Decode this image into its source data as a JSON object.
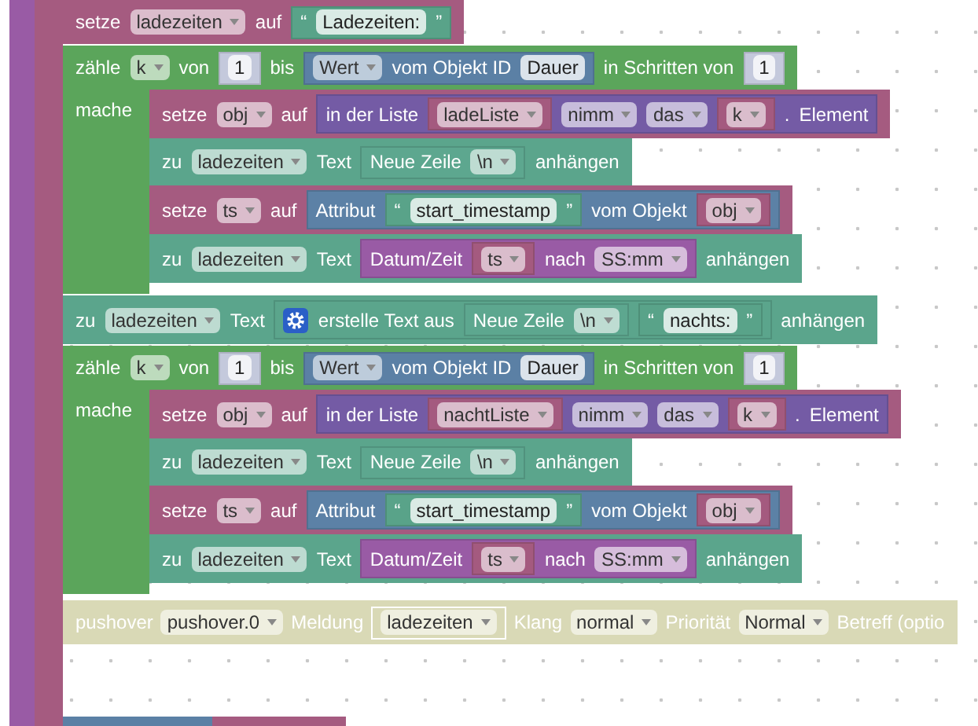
{
  "stack": [
    {
      "kind": "set",
      "parts": [
        {
          "kind": "label",
          "text": "setze"
        },
        {
          "kind": "dropdown",
          "text": "ladezeiten"
        },
        {
          "kind": "label",
          "text": "auf"
        },
        {
          "kind": "block",
          "block": {
            "kind": "string",
            "parts": [
              {
                "kind": "label",
                "text": "“"
              },
              {
                "kind": "field",
                "text": "Ladezeiten:"
              },
              {
                "kind": "label",
                "text": "”"
              }
            ]
          }
        }
      ]
    },
    {
      "kind": "count",
      "parts": [
        {
          "kind": "label",
          "text": "zähle"
        },
        {
          "kind": "dropdown",
          "text": "k"
        },
        {
          "kind": "label",
          "text": "von"
        },
        {
          "kind": "block",
          "block": {
            "kind": "number",
            "parts": [
              {
                "kind": "field",
                "text": "1"
              }
            ]
          }
        },
        {
          "kind": "label",
          "text": "bis"
        },
        {
          "kind": "block",
          "block": {
            "kind": "object_value",
            "parts": [
              {
                "kind": "dropdown",
                "text": "Wert"
              },
              {
                "kind": "label",
                "text": "vom Objekt ID"
              },
              {
                "kind": "field",
                "text": "Dauer"
              }
            ]
          }
        },
        {
          "kind": "label",
          "text": "in Schritten von"
        },
        {
          "kind": "block",
          "block": {
            "kind": "number",
            "parts": [
              {
                "kind": "field",
                "text": "1"
              }
            ]
          }
        }
      ],
      "body_label": "mache",
      "body": [
        {
          "kind": "set",
          "parts": [
            {
              "kind": "label",
              "text": "setze"
            },
            {
              "kind": "dropdown",
              "text": "obj"
            },
            {
              "kind": "label",
              "text": "auf"
            },
            {
              "kind": "block",
              "block": {
                "kind": "list_get",
                "parts": [
                  {
                    "kind": "label",
                    "text": "in der Liste"
                  },
                  {
                    "kind": "block",
                    "block": {
                      "kind": "var",
                      "parts": [
                        {
                          "kind": "dropdown",
                          "text": "ladeListe"
                        }
                      ]
                    }
                  },
                  {
                    "kind": "dropdown",
                    "text": "nimm"
                  },
                  {
                    "kind": "dropdown",
                    "text": "das"
                  },
                  {
                    "kind": "block",
                    "block": {
                      "kind": "var",
                      "parts": [
                        {
                          "kind": "dropdown",
                          "text": "k"
                        }
                      ]
                    }
                  },
                  {
                    "kind": "label",
                    "text": "."
                  },
                  {
                    "kind": "label",
                    "text": "Element"
                  }
                ]
              }
            }
          ]
        },
        {
          "kind": "append",
          "parts": [
            {
              "kind": "label",
              "text": "zu"
            },
            {
              "kind": "dropdown",
              "text": "ladezeiten"
            },
            {
              "kind": "label",
              "text": "Text"
            },
            {
              "kind": "block",
              "block": {
                "kind": "newline",
                "parts": [
                  {
                    "kind": "label",
                    "text": "Neue Zeile"
                  },
                  {
                    "kind": "dropdown",
                    "text": "\\n"
                  }
                ]
              }
            },
            {
              "kind": "label",
              "text": "anhängen"
            }
          ]
        },
        {
          "kind": "set",
          "parts": [
            {
              "kind": "label",
              "text": "setze"
            },
            {
              "kind": "dropdown",
              "text": "ts"
            },
            {
              "kind": "label",
              "text": "auf"
            },
            {
              "kind": "block",
              "block": {
                "kind": "attribute",
                "parts": [
                  {
                    "kind": "label",
                    "text": "Attribut"
                  },
                  {
                    "kind": "block",
                    "block": {
                      "kind": "string",
                      "parts": [
                        {
                          "kind": "label",
                          "text": "“"
                        },
                        {
                          "kind": "field",
                          "text": "start_timestamp"
                        },
                        {
                          "kind": "label",
                          "text": "”"
                        }
                      ]
                    }
                  },
                  {
                    "kind": "label",
                    "text": "vom Objekt"
                  },
                  {
                    "kind": "block",
                    "block": {
                      "kind": "var",
                      "parts": [
                        {
                          "kind": "dropdown",
                          "text": "obj"
                        }
                      ]
                    }
                  }
                ]
              }
            }
          ]
        },
        {
          "kind": "append",
          "parts": [
            {
              "kind": "label",
              "text": "zu"
            },
            {
              "kind": "dropdown",
              "text": "ladezeiten"
            },
            {
              "kind": "label",
              "text": "Text"
            },
            {
              "kind": "block",
              "block": {
                "kind": "datetime",
                "parts": [
                  {
                    "kind": "label",
                    "text": "Datum/Zeit"
                  },
                  {
                    "kind": "block",
                    "block": {
                      "kind": "var",
                      "parts": [
                        {
                          "kind": "dropdown",
                          "text": "ts"
                        }
                      ]
                    }
                  },
                  {
                    "kind": "label",
                    "text": "nach"
                  },
                  {
                    "kind": "dropdown",
                    "text": "SS:mm"
                  }
                ]
              }
            },
            {
              "kind": "label",
              "text": "anhängen"
            }
          ]
        }
      ]
    },
    {
      "kind": "append",
      "parts": [
        {
          "kind": "label",
          "text": "zu"
        },
        {
          "kind": "dropdown",
          "text": "ladezeiten"
        },
        {
          "kind": "label",
          "text": "Text"
        },
        {
          "kind": "block",
          "block": {
            "kind": "create_text",
            "parts": [
              {
                "kind": "mutator"
              },
              {
                "kind": "label",
                "text": "erstelle Text aus"
              },
              {
                "kind": "block",
                "block": {
                  "kind": "newline",
                  "parts": [
                    {
                      "kind": "label",
                      "text": "Neue Zeile"
                    },
                    {
                      "kind": "dropdown",
                      "text": "\\n"
                    }
                  ]
                }
              },
              {
                "kind": "block",
                "block": {
                  "kind": "string",
                  "parts": [
                    {
                      "kind": "label",
                      "text": "“"
                    },
                    {
                      "kind": "field",
                      "text": "nachts:"
                    },
                    {
                      "kind": "label",
                      "text": "”"
                    }
                  ]
                }
              }
            ]
          }
        },
        {
          "kind": "label",
          "text": "anhängen"
        }
      ]
    },
    {
      "kind": "count",
      "parts": [
        {
          "kind": "label",
          "text": "zähle"
        },
        {
          "kind": "dropdown",
          "text": "k"
        },
        {
          "kind": "label",
          "text": "von"
        },
        {
          "kind": "block",
          "block": {
            "kind": "number",
            "parts": [
              {
                "kind": "field",
                "text": "1"
              }
            ]
          }
        },
        {
          "kind": "label",
          "text": "bis"
        },
        {
          "kind": "block",
          "block": {
            "kind": "object_value",
            "parts": [
              {
                "kind": "dropdown",
                "text": "Wert"
              },
              {
                "kind": "label",
                "text": "vom Objekt ID"
              },
              {
                "kind": "field",
                "text": "Dauer"
              }
            ]
          }
        },
        {
          "kind": "label",
          "text": "in Schritten von"
        },
        {
          "kind": "block",
          "block": {
            "kind": "number",
            "parts": [
              {
                "kind": "field",
                "text": "1"
              }
            ]
          }
        }
      ],
      "body_label": "mache",
      "body": [
        {
          "kind": "set",
          "parts": [
            {
              "kind": "label",
              "text": "setze"
            },
            {
              "kind": "dropdown",
              "text": "obj"
            },
            {
              "kind": "label",
              "text": "auf"
            },
            {
              "kind": "block",
              "block": {
                "kind": "list_get",
                "parts": [
                  {
                    "kind": "label",
                    "text": "in der Liste"
                  },
                  {
                    "kind": "block",
                    "block": {
                      "kind": "var",
                      "parts": [
                        {
                          "kind": "dropdown",
                          "text": "nachtListe"
                        }
                      ]
                    }
                  },
                  {
                    "kind": "dropdown",
                    "text": "nimm"
                  },
                  {
                    "kind": "dropdown",
                    "text": "das"
                  },
                  {
                    "kind": "block",
                    "block": {
                      "kind": "var",
                      "parts": [
                        {
                          "kind": "dropdown",
                          "text": "k"
                        }
                      ]
                    }
                  },
                  {
                    "kind": "label",
                    "text": "."
                  },
                  {
                    "kind": "label",
                    "text": "Element"
                  }
                ]
              }
            }
          ]
        },
        {
          "kind": "append",
          "parts": [
            {
              "kind": "label",
              "text": "zu"
            },
            {
              "kind": "dropdown",
              "text": "ladezeiten"
            },
            {
              "kind": "label",
              "text": "Text"
            },
            {
              "kind": "block",
              "block": {
                "kind": "newline",
                "parts": [
                  {
                    "kind": "label",
                    "text": "Neue Zeile"
                  },
                  {
                    "kind": "dropdown",
                    "text": "\\n"
                  }
                ]
              }
            },
            {
              "kind": "label",
              "text": "anhängen"
            }
          ]
        },
        {
          "kind": "set",
          "parts": [
            {
              "kind": "label",
              "text": "setze"
            },
            {
              "kind": "dropdown",
              "text": "ts"
            },
            {
              "kind": "label",
              "text": "auf"
            },
            {
              "kind": "block",
              "block": {
                "kind": "attribute",
                "parts": [
                  {
                    "kind": "label",
                    "text": "Attribut"
                  },
                  {
                    "kind": "block",
                    "block": {
                      "kind": "string",
                      "parts": [
                        {
                          "kind": "label",
                          "text": "“"
                        },
                        {
                          "kind": "field",
                          "text": "start_timestamp"
                        },
                        {
                          "kind": "label",
                          "text": "”"
                        }
                      ]
                    }
                  },
                  {
                    "kind": "label",
                    "text": "vom Objekt"
                  },
                  {
                    "kind": "block",
                    "block": {
                      "kind": "var",
                      "parts": [
                        {
                          "kind": "dropdown",
                          "text": "obj"
                        }
                      ]
                    }
                  }
                ]
              }
            }
          ]
        },
        {
          "kind": "append",
          "parts": [
            {
              "kind": "label",
              "text": "zu"
            },
            {
              "kind": "dropdown",
              "text": "ladezeiten"
            },
            {
              "kind": "label",
              "text": "Text"
            },
            {
              "kind": "block",
              "block": {
                "kind": "datetime",
                "parts": [
                  {
                    "kind": "label",
                    "text": "Datum/Zeit"
                  },
                  {
                    "kind": "block",
                    "block": {
                      "kind": "var",
                      "parts": [
                        {
                          "kind": "dropdown",
                          "text": "ts"
                        }
                      ]
                    }
                  },
                  {
                    "kind": "label",
                    "text": "nach"
                  },
                  {
                    "kind": "dropdown",
                    "text": "SS:mm"
                  }
                ]
              }
            },
            {
              "kind": "label",
              "text": "anhängen"
            }
          ]
        }
      ]
    },
    {
      "kind": "pushover",
      "disabled": true,
      "parts": [
        {
          "kind": "label",
          "text": "pushover"
        },
        {
          "kind": "dropdown",
          "text": "pushover.0"
        },
        {
          "kind": "label",
          "text": "Meldung"
        },
        {
          "kind": "block",
          "block": {
            "kind": "var",
            "parts": [
              {
                "kind": "dropdown",
                "text": "ladezeiten"
              }
            ]
          }
        },
        {
          "kind": "label",
          "text": "Klang"
        },
        {
          "kind": "dropdown",
          "text": "normal"
        },
        {
          "kind": "label",
          "text": "Priorität"
        },
        {
          "kind": "dropdown",
          "text": "Normal"
        },
        {
          "kind": "label",
          "text": "Betreff (optio"
        }
      ]
    }
  ]
}
